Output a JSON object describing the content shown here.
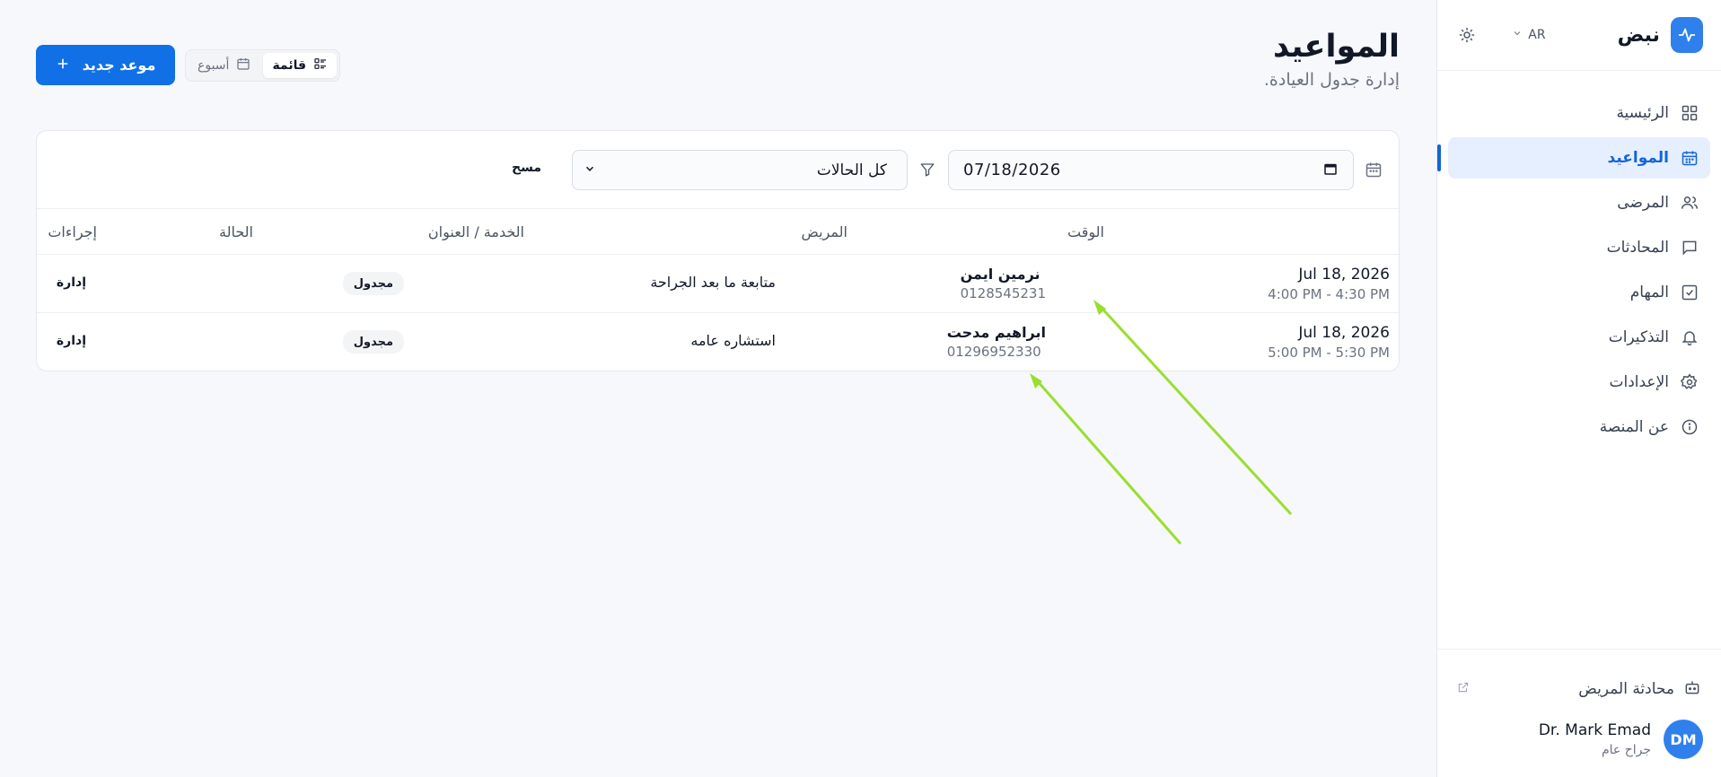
{
  "brand": {
    "name": "نبض",
    "accent": "#2f80ed"
  },
  "header": {
    "language": "AR",
    "theme_icon": "sun-icon"
  },
  "sidebar": {
    "items": [
      {
        "label": "الرئيسية",
        "icon": "dashboard-icon"
      },
      {
        "label": "المواعيد",
        "icon": "calendar-icon",
        "active": true
      },
      {
        "label": "المرضى",
        "icon": "users-icon"
      },
      {
        "label": "المحادثات",
        "icon": "chat-icon"
      },
      {
        "label": "المهام",
        "icon": "checkbox-icon"
      },
      {
        "label": "التذكيرات",
        "icon": "bell-icon"
      },
      {
        "label": "الإعدادات",
        "icon": "gear-icon"
      },
      {
        "label": "عن المنصة",
        "icon": "info-icon"
      }
    ],
    "patient_chat": "محادثة المريض",
    "user": {
      "initials": "DM",
      "name": "Dr. Mark Emad",
      "role": "جراح عام"
    }
  },
  "page": {
    "title": "المواعيد",
    "subtitle": "إدارة جدول العيادة.",
    "view_list": "قائمة",
    "view_week": "أسبوع",
    "new_button": "موعد جديد"
  },
  "filters": {
    "date": "07/18/2026",
    "status": "كل الحالات",
    "clear": "مسح"
  },
  "table": {
    "headers": {
      "time": "الوقت",
      "patient": "المريض",
      "service": "الخدمة / العنوان",
      "status": "الحالة",
      "actions": "إجراءات"
    },
    "rows": [
      {
        "date": "Jul 18, 2026",
        "time": "4:00 PM - 4:30 PM",
        "patient": "نرمين ايمن",
        "phone": "0128545231",
        "service": "متابعة ما بعد الجراحة",
        "status": "مجدول",
        "action": "إدارة"
      },
      {
        "date": "Jul 18, 2026",
        "time": "5:00 PM - 5:30 PM",
        "patient": "ابراهيم مدحت",
        "phone": "01296952330",
        "service": "استشاره عامه",
        "status": "مجدول",
        "action": "إدارة"
      }
    ]
  },
  "annotation_color": "#9ade2f"
}
